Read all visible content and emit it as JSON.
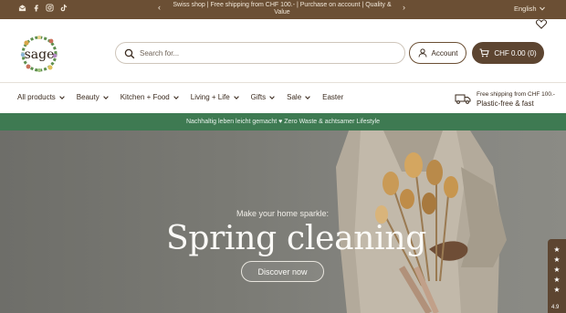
{
  "topbar": {
    "social": [
      "mail-icon",
      "facebook-icon",
      "instagram-icon",
      "tiktok-icon"
    ],
    "announcement": "Swiss shop | Free shipping from CHF 100.- | Purchase on account | Quality & Value",
    "prev_arrow": "‹",
    "next_arrow": "›",
    "language": "English"
  },
  "header": {
    "logo_text": "sage",
    "search_placeholder": "Search for...",
    "account_label": "Account",
    "cart_label": "CHF 0.00 (0)"
  },
  "nav": {
    "items": [
      {
        "label": "All products",
        "has_menu": true
      },
      {
        "label": "Beauty",
        "has_menu": true
      },
      {
        "label": "Kitchen + Food",
        "has_menu": true
      },
      {
        "label": "Living + Life",
        "has_menu": true
      },
      {
        "label": "Gifts",
        "has_menu": true
      },
      {
        "label": "Sale",
        "has_menu": true
      },
      {
        "label": "Easter",
        "has_menu": false
      }
    ],
    "shipping_line1": "Free shipping from CHF 100.-",
    "shipping_line2": "Plastic-free & fast"
  },
  "banner": {
    "text": "Nachhaltig leben leicht gemacht ♥ Zero Waste & achtsamer Lifestyle"
  },
  "hero": {
    "kicker": "Make your home sparkle:",
    "title": "Spring cleaning",
    "cta": "Discover now"
  },
  "reviews": {
    "stars": [
      "★",
      "★",
      "★",
      "★",
      "★"
    ],
    "score": "4.9"
  },
  "colors": {
    "brand_brown": "#6b4f34",
    "dark_brown": "#5d4531",
    "green": "#3e7a52"
  }
}
